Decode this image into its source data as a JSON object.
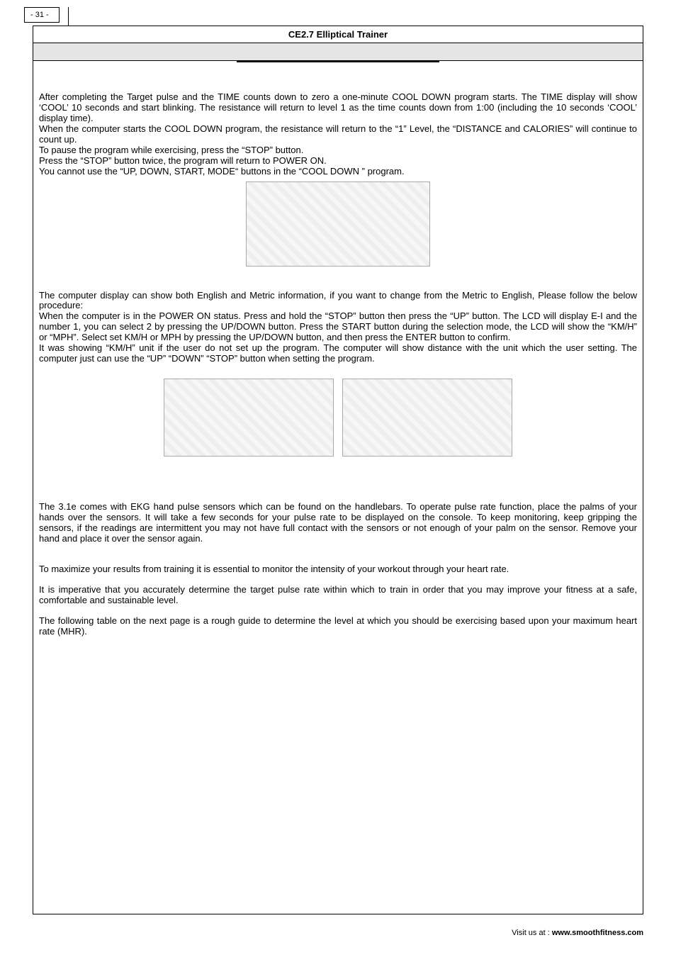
{
  "page_number_label": "- 31 -",
  "header_title": "CE2.7 Elliptical Trainer",
  "paragraphs": {
    "p1": "After completing the Target pulse and the TIME counts down to zero a one-minute COOL DOWN program starts. The TIME display will show ‘COOL’ 10 seconds and start blinking. The resistance will return to level 1 as the time counts down from 1:00 (including the 10 seconds ‘COOL’ display time).",
    "p2": "When the computer starts the COOL DOWN program, the resistance will return to the “1” Level, the “DISTANCE and CALORIES” will continue to count up.",
    "p3": "To pause the program while exercising, press the “STOP” button.",
    "p4": "Press the “STOP” button twice, the program will return to POWER ON.",
    "p5": "You cannot use the “UP, DOWN, START, MODE“ buttons in the “COOL DOWN ” program.",
    "p6": "The computer display can show both English and Metric information, if you want to change from the Metric to English, Please follow the below procedure:",
    "p7": "When the computer is in the POWER ON status. Press and hold the “STOP” button then press the “UP” button. The LCD will display E-I and the number 1, you can select 2 by pressing the UP/DOWN button. Press the START button during the selection mode, the LCD will show the “KM/H” or “MPH”. Select set KM/H or MPH by pressing the UP/DOWN button, and then press the ENTER button to confirm.",
    "p8": "It was showing “KM/H” unit if the user do not set up the program. The computer will show distance with the unit which the user setting. The computer just can use the “UP” “DOWN” “STOP” button when setting the program.",
    "p9": "The 3.1e comes with EKG hand pulse sensors which can be found on the handlebars. To operate pulse rate function, place the palms of your hands over the sensors. It will take a few seconds for your pulse rate to be displayed on the console. To keep monitoring, keep gripping the sensors, if the readings are intermittent you may not have full contact with the sensors or not enough of your palm on the sensor. Remove your hand and place it over the sensor again.",
    "p10": "To maximize your results from training it is essential to monitor the intensity of your workout through your heart rate.",
    "p11": "It is imperative that you accurately determine the target pulse rate within which to train in order that you may improve your fitness at a safe, comfortable and sustainable level.",
    "p12": "The following table on the next page is a rough guide to determine the level at which you should be exercising based upon your maximum heart rate (MHR)."
  },
  "footer_prefix": "Visit us at : ",
  "footer_url": "www.smoothfitness.com"
}
